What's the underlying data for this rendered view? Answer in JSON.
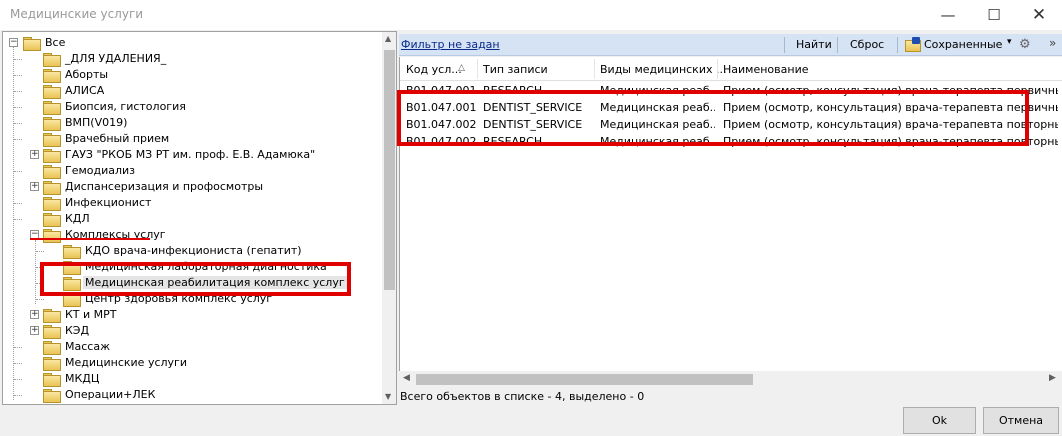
{
  "window": {
    "title": "Медицинские услуги",
    "minimize": "—",
    "maximize": "☐",
    "close": "✕"
  },
  "tree": {
    "items": [
      {
        "label": "Все",
        "expander": "−",
        "level": 0
      },
      {
        "label": "_ДЛЯ УДАЛЕНИЯ_",
        "level": 1
      },
      {
        "label": "Аборты",
        "level": 1
      },
      {
        "label": "АЛИСА",
        "level": 1
      },
      {
        "label": "Биопсия, гистология",
        "level": 1
      },
      {
        "label": "ВМП(V019)",
        "level": 1
      },
      {
        "label": "Врачебный прием",
        "level": 1
      },
      {
        "label": "ГАУЗ \"РКОБ МЗ РТ им. проф. Е.В. Адамюка\"",
        "expander": "+",
        "level": 1
      },
      {
        "label": "Гемодиализ",
        "level": 1
      },
      {
        "label": "Диспансеризация и профосмотры",
        "expander": "+",
        "level": 1
      },
      {
        "label": "Инфекционист",
        "level": 1
      },
      {
        "label": "КДЛ",
        "level": 1
      },
      {
        "label": "Комплексы услуг",
        "expander": "−",
        "level": 1
      },
      {
        "label": "КДО врача-инфекциониста (гепатит)",
        "level": 2
      },
      {
        "label": "Медицинская лабораторная диагностика",
        "level": 2
      },
      {
        "label": "Медицинская реабилитация комплекс услуг",
        "level": 2,
        "selected": true
      },
      {
        "label": "Центр здоровья комплекс услуг",
        "level": 2
      },
      {
        "label": "КТ и МРТ",
        "expander": "+",
        "level": 1
      },
      {
        "label": "КЭД",
        "expander": "+",
        "level": 1
      },
      {
        "label": "Массаж",
        "level": 1
      },
      {
        "label": "Медицинские услуги",
        "level": 1
      },
      {
        "label": "МКДЦ",
        "level": 1
      },
      {
        "label": "Операции+ЛЕК",
        "level": 1
      }
    ]
  },
  "toolbar": {
    "filter_label": "Фильтр не задан",
    "find_label": "Найти",
    "reset_label": "Сброс",
    "saved_label": "Сохраненные",
    "dropdown": "▾",
    "more": "»"
  },
  "grid": {
    "columns": [
      "Код усл...",
      "Тип записи",
      "Виды медицинских ...",
      "Наименование"
    ],
    "sort_indicator": "△",
    "rows": [
      [
        "B01.047.001",
        "RESEARCH",
        "Медицинская реаб...",
        "Прием (осмотр, консультация) врача-терапевта первичный"
      ],
      [
        "B01.047.001",
        "DENTIST_SERVICE",
        "Медицинская реаб...",
        "Прием (осмотр, консультация) врача-терапевта первичный"
      ],
      [
        "B01.047.002",
        "DENTIST_SERVICE",
        "Медицинская реаб...",
        "Прием (осмотр, консультация) врача-терапевта повторный"
      ],
      [
        "B01.047.002",
        "RESEARCH",
        "Медицинская реаб...",
        "Прием (осмотр, консультация) врача-терапевта повторный"
      ]
    ]
  },
  "status": {
    "text": "Всего объектов в списке - 4, выделено - 0"
  },
  "buttons": {
    "ok": "Ok",
    "cancel": "Отмена"
  },
  "colors": {
    "highlight": "#e00000",
    "toolbar_bg": "#d6e3f4",
    "link": "#0a2a8a"
  }
}
